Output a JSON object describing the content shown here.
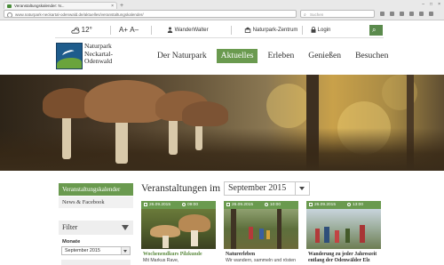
{
  "browser": {
    "tab_title": "Veranstaltungskalender: N...",
    "url": "www.naturpark-neckartal-odenwald.de/aktuelles/veranstaltungskalender/",
    "search_placeholder": "Suchen",
    "new_tab": "+",
    "tab_close": "×",
    "window_buttons": [
      "–",
      "□",
      "×"
    ]
  },
  "utility": {
    "weather_icon": "cloud-sun-icon",
    "temperature": "12°",
    "font_larger": "A+",
    "font_smaller": "A–",
    "wanderwalter": "WanderWalter",
    "naturpark_zentrum": "Naturpark-Zentrum",
    "login": "Login",
    "search_icon": "search-icon"
  },
  "header": {
    "logo_line1": "Naturpark",
    "logo_line2": "Neckartal-",
    "logo_line3": "Odenwald",
    "nav": [
      "Der Naturpark",
      "Aktuelles",
      "Erleben",
      "Genießen",
      "Besuchen"
    ],
    "active_nav": "Aktuelles"
  },
  "sidebar": {
    "active_item": "Veranstaltungskalender",
    "item2": "News & Facebook",
    "filter_title": "Filter",
    "month_label": "Monate",
    "month_value": "September 2015"
  },
  "main": {
    "heading": "Veranstaltungen im",
    "month_select": "September 2015"
  },
  "cards": [
    {
      "date": "26.09.2015",
      "time": "09:00",
      "title": "Wochenendkurs Pilzkunde",
      "subtitle": "Mit Markus Rave,"
    },
    {
      "date": "26.09.2015",
      "time": "10:00",
      "title": "Naturerleben",
      "subtitle": "Wir wandern, sammeln und rösten"
    },
    {
      "date": "26.09.2015",
      "time": "13:00",
      "title": "Wanderung zu jeder Jahreszeit entlang der Odenwälder Elz",
      "subtitle": ""
    }
  ],
  "colors": {
    "accent_green": "#6a9a4f",
    "search_button": "#5a8a4c"
  }
}
